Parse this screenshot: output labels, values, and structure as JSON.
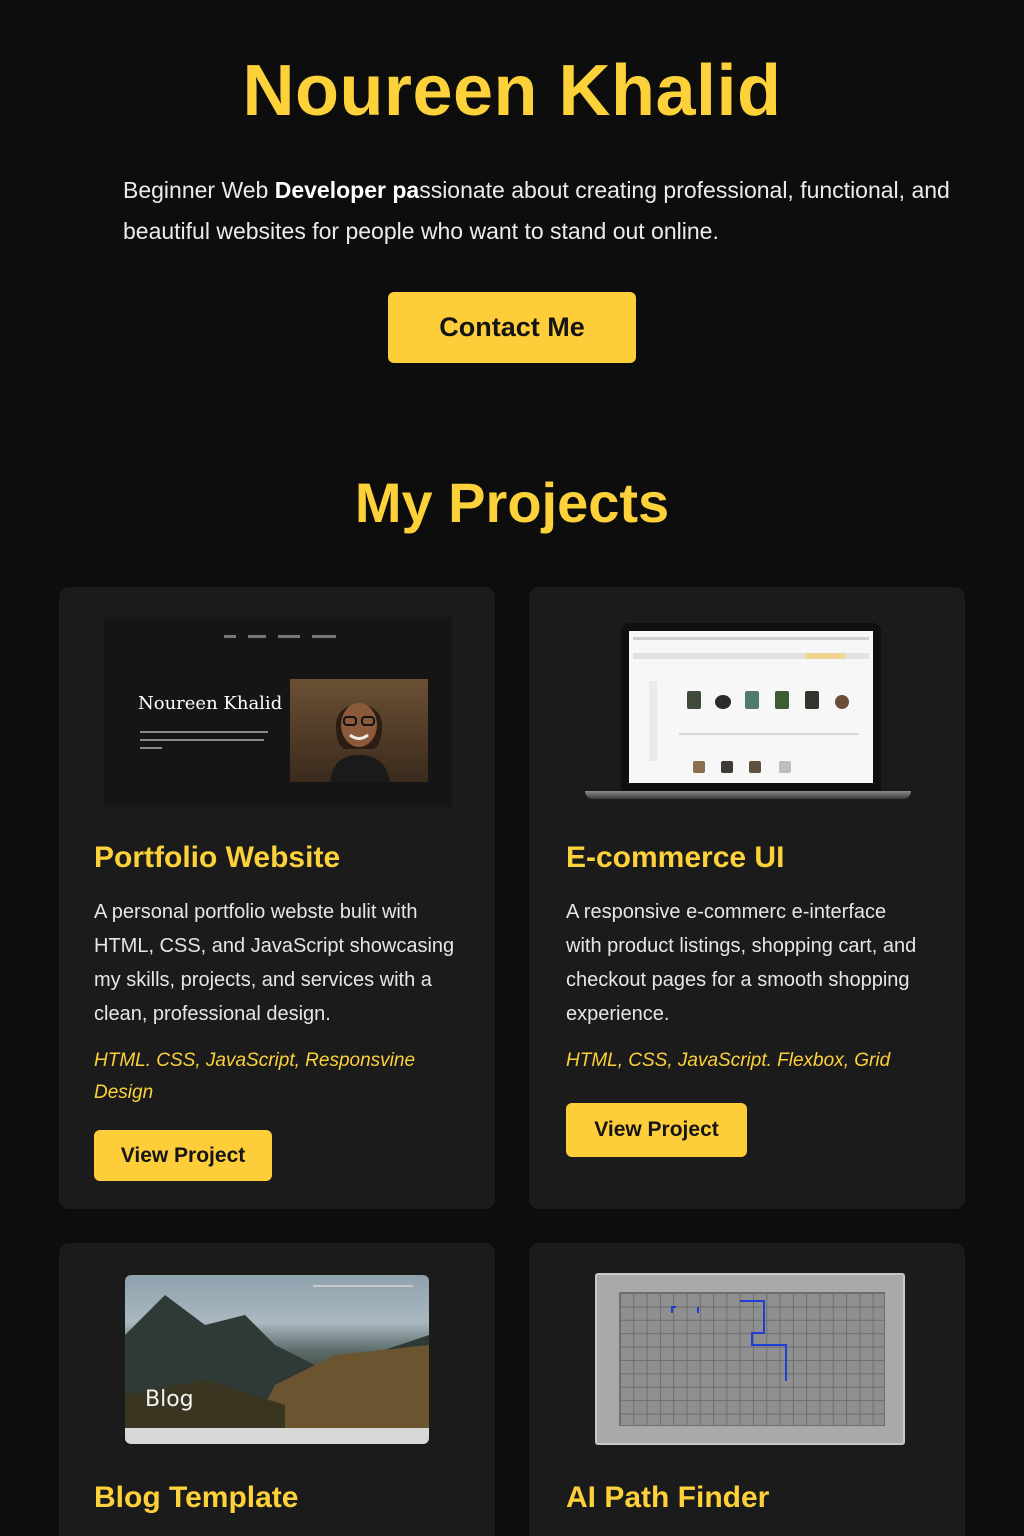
{
  "hero": {
    "name": "Noureen Khalid",
    "desc_part1": "Beginner Web ",
    "desc_bold": "Developer pa",
    "desc_part2": "ssionate about creating professional, functional, and beautiful websites for people who want to stand out online.",
    "contact_label": "Contact Me"
  },
  "projects": {
    "title": "My Projects",
    "items": [
      {
        "title": "Portfolio Website",
        "desc": "A personal portfolio webste bulit with HTML, CSS, and JavaScript showcasing my skills, projects, and services with a clean, professional design.",
        "tags": "HTML. CSS,  JavaScript, Responsvine Design",
        "button": "View Project",
        "thumb_name": "Noureen Khalid"
      },
      {
        "title": "E-commerce UI",
        "desc": "A responsive e-commerc e-interface with product listings, shopping cart, and checkout pages for a smooth shopping experience.",
        "tags": "HTML, CSS, JavaScript. Flexbox, Grid",
        "button": "View Project"
      },
      {
        "title": "Blog Template",
        "thumb_label": "Blog"
      },
      {
        "title": "AI Path Finder"
      }
    ]
  },
  "colors": {
    "accent": "#fdd13a",
    "background": "#0d0d0d",
    "card": "#1b1b1b",
    "path": "#1d3fd6"
  }
}
